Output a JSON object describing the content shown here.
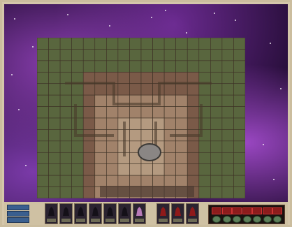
{
  "colors": {
    "board_edge_tile": "#59663e",
    "board_path_tile": "#7a5a48",
    "board_inner_tile": "#a1826a",
    "board_core_tile": "#b49a80",
    "space": "#2a0f3d",
    "hud": "#cfc1a3"
  },
  "hud": {
    "left_buttons": [
      "menu-button",
      "options-button",
      "end-turn-button"
    ],
    "units": [
      {
        "name": "unit-1",
        "tone": "dark"
      },
      {
        "name": "unit-2",
        "tone": "dark"
      },
      {
        "name": "unit-3",
        "tone": "dark"
      },
      {
        "name": "unit-4",
        "tone": "dark"
      },
      {
        "name": "unit-5",
        "tone": "dark"
      },
      {
        "name": "unit-6",
        "tone": "dark"
      },
      {
        "name": "unit-7",
        "tone": "pink"
      },
      {
        "name": "unit-8",
        "tone": "red"
      },
      {
        "name": "unit-9",
        "tone": "red"
      },
      {
        "name": "unit-10",
        "tone": "red"
      }
    ],
    "scoreboard_slots": 7
  }
}
